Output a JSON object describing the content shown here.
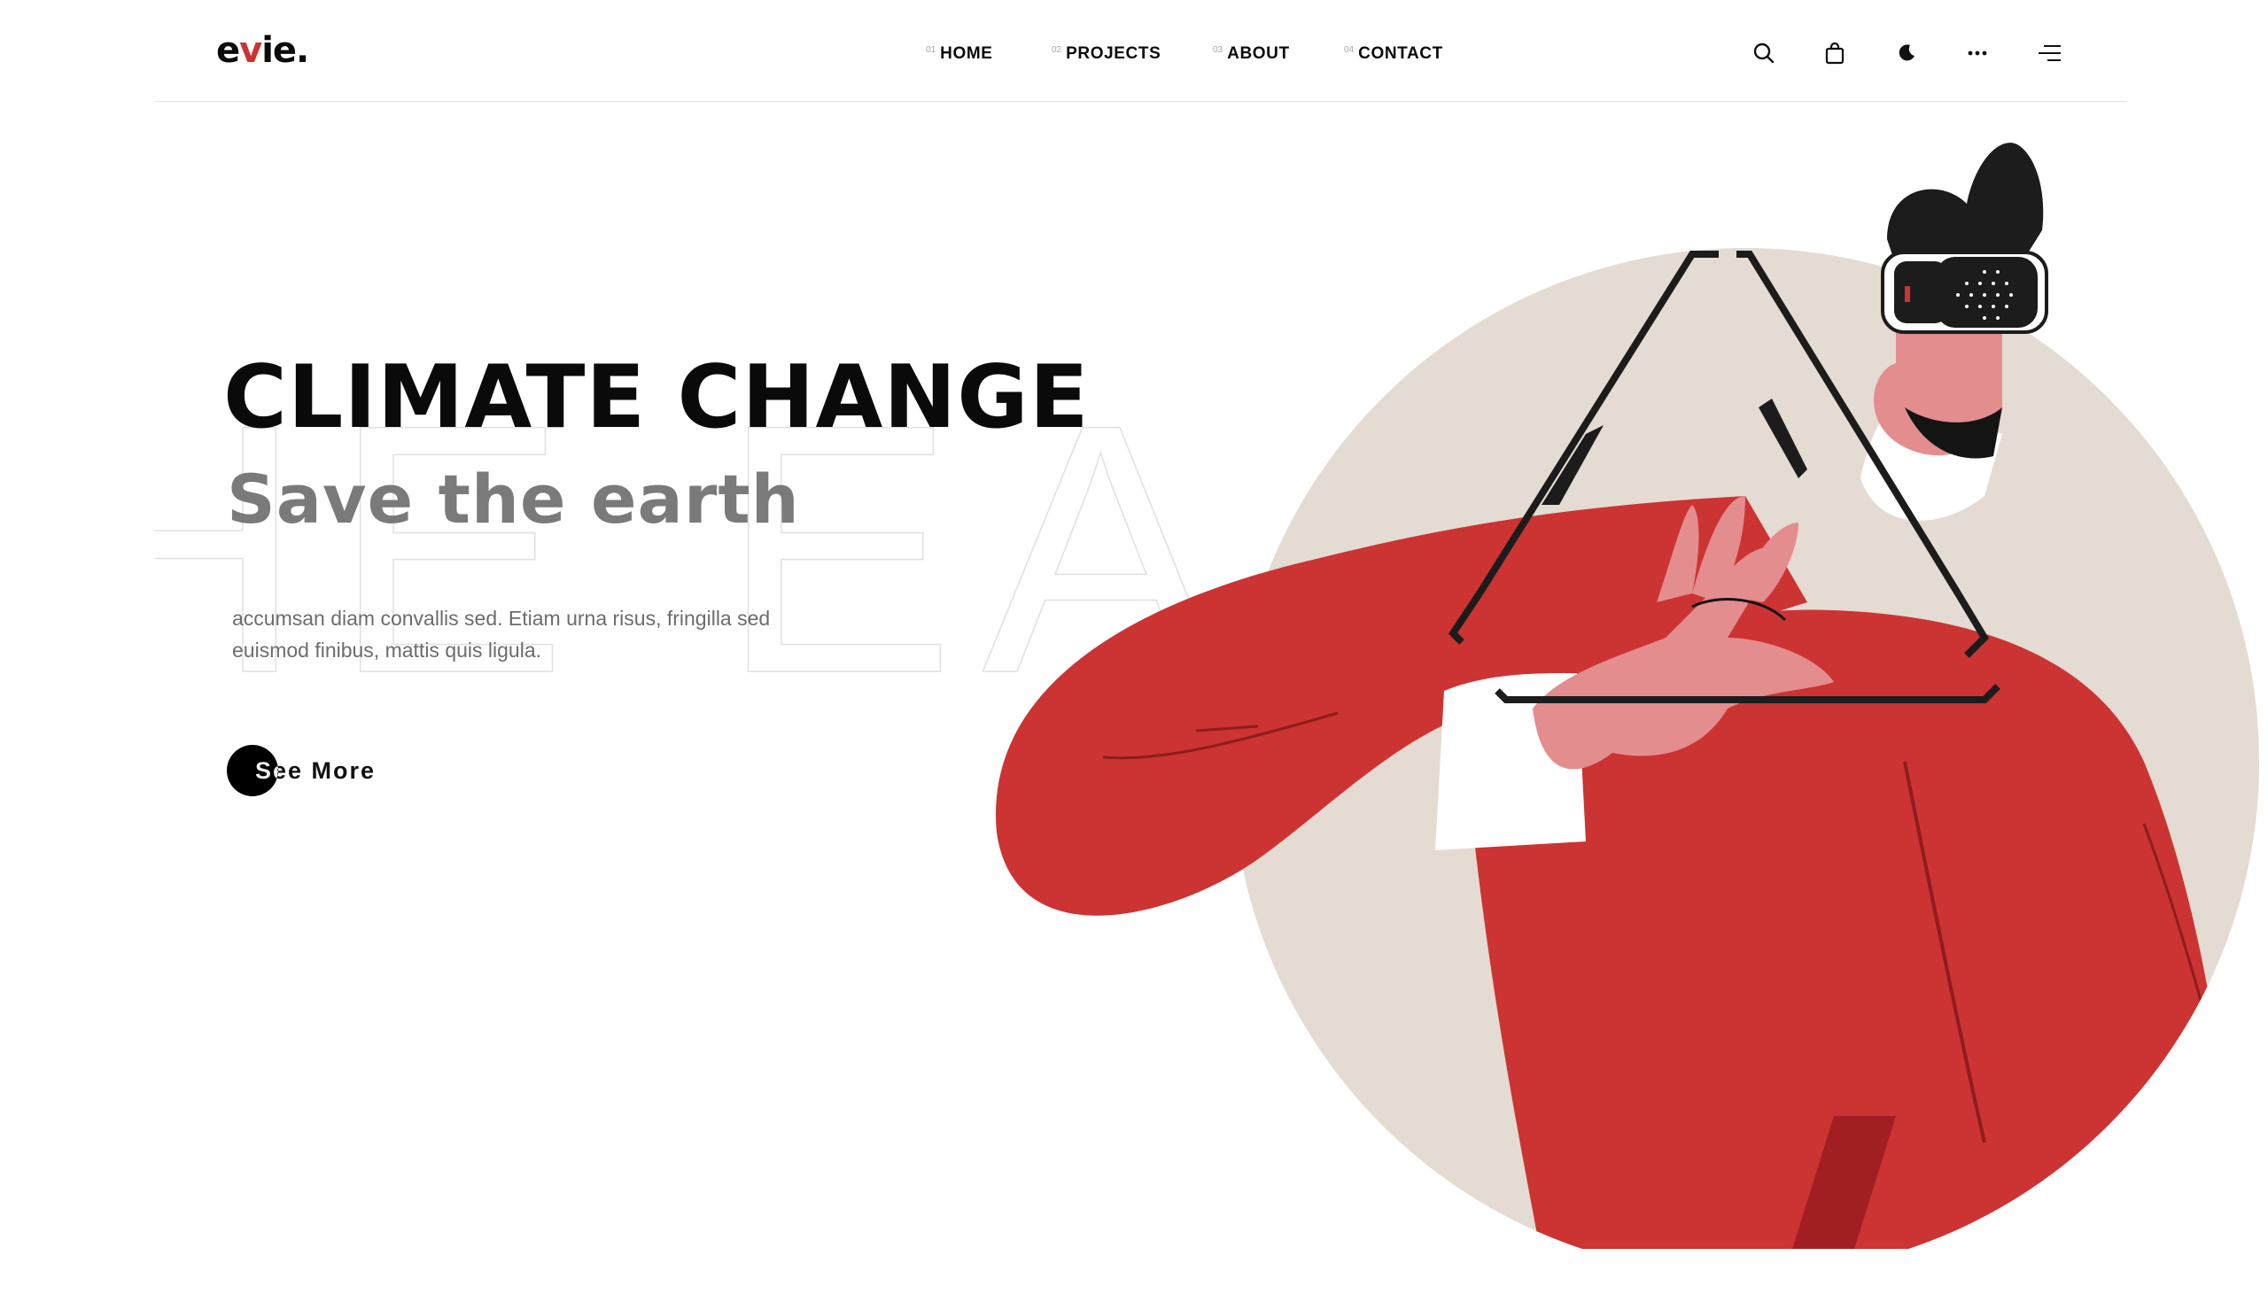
{
  "brand": {
    "logo_pre": "e",
    "logo_accent": "v",
    "logo_post": "ie."
  },
  "nav": [
    {
      "num": "01",
      "label": "HOME"
    },
    {
      "num": "02",
      "label": "PROJECTS"
    },
    {
      "num": "03",
      "label": "ABOUT"
    },
    {
      "num": "04",
      "label": "CONTACT"
    }
  ],
  "header_icons": [
    "search-icon",
    "shopping-bag-icon",
    "dark-mode-icon",
    "more-options-icon",
    "menu-icon"
  ],
  "hero": {
    "title": "CLIMATE CHANGE",
    "subtitle": "Save the earth",
    "description": "accumsan diam convallis sed. Etiam urna risus, fringilla sed euismod finibus, mattis quis ligula.",
    "cta": "See More"
  },
  "colors": {
    "accent": "#cc3333",
    "circle": "#e4dbd2",
    "skin": "#e48d8e",
    "text": "#0a0a0a",
    "muted": "#7a7a7a"
  }
}
